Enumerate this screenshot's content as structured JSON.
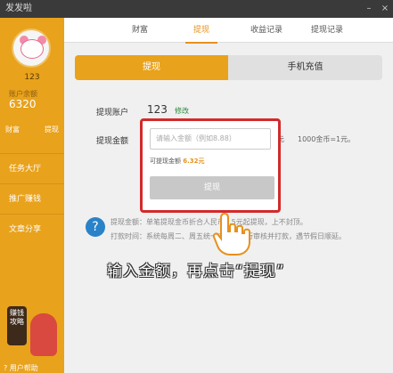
{
  "window": {
    "title": "发发啦",
    "btn_min": "–",
    "btn_close": "×"
  },
  "sidebar": {
    "username": "123",
    "balance_label": "账户余额",
    "balance": "6320",
    "actions": [
      "财富",
      "提现"
    ],
    "menu": [
      "任务大厅",
      "推广赚钱",
      "文章分享"
    ],
    "badge_text": "赚钱攻略",
    "help": "用户帮助"
  },
  "tabs": [
    "财富",
    "提现",
    "收益记录",
    "提现记录"
  ],
  "subtabs": {
    "left": "提现",
    "right": "手机充值"
  },
  "form": {
    "account_label": "提现账户",
    "account_value": "123",
    "edit": "修改",
    "amount_label": "提现金额",
    "note_a": "元",
    "note_b": "1000金币=1元。"
  },
  "popup": {
    "placeholder": "请输入金额（例如8.88）",
    "available_label": "可提现金额",
    "available_value": "6.32元",
    "withdraw_btn": "提现"
  },
  "info": {
    "line1": "提现金额：单笔提现金币折合人民币0.5元起提现，上不封顶。",
    "line2": "打款时间：系统每周二、周五统一对申请进行审核并打款，遇节假日顺延。"
  },
  "hint": "输入金额，再点击“提现”"
}
